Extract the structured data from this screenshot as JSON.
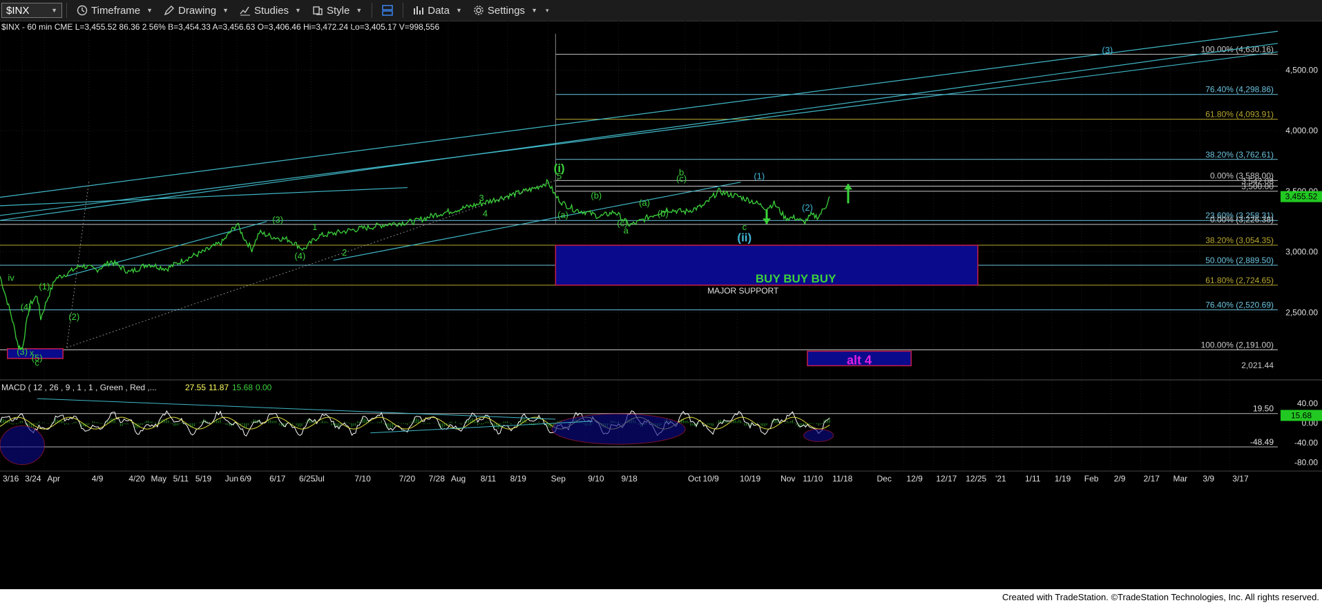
{
  "toolbar": {
    "symbol": "$INX",
    "items": [
      {
        "label": "Timeframe",
        "icon": "clock-icon"
      },
      {
        "label": "Drawing",
        "icon": "pencil-icon"
      },
      {
        "label": "Studies",
        "icon": "studies-icon"
      },
      {
        "label": "Style",
        "icon": "style-icon"
      },
      {
        "label": "Data",
        "icon": "data-icon"
      },
      {
        "label": "Settings",
        "icon": "gear-icon"
      }
    ]
  },
  "info_line": "$INX - 60 min  CME  L=3,455.52  86.36  2.56%  B=3,454.33  A=3,456.63  O=3,406.46  Hi=3,472.24  Lo=3,405.17  V=998,556",
  "footer": "Created with TradeStation. ©TradeStation Technologies, Inc. All rights reserved.",
  "colors": {
    "price": "#3cd23c",
    "trend": "#40b8c8",
    "support_box": "#0a0a8c",
    "support_border": "#c81e4b",
    "fib_blue": "#6cc4e0",
    "fib_olive": "#b8a830",
    "label_green": "#3cd23c",
    "label_cyan": "#40b8d8",
    "last_price_bg": "#22c822",
    "alt_text": "#e020e0"
  },
  "chart_data": [
    {
      "type": "line",
      "name": "price",
      "title": "$INX - 60 min",
      "ylim": [
        2000,
        4850
      ],
      "y_ticks": [
        2500,
        3000,
        3500,
        4000,
        4500
      ],
      "y_tick_labels": [
        "2,500.00",
        "3,000.00",
        "3,500.00",
        "4,000.00",
        "4,500.00"
      ],
      "last_price_label": "3,455.52",
      "x_tick_labels": [
        "3/16",
        "3/24",
        "Apr",
        "4/9",
        "4/20",
        "May",
        "5/11",
        "5/19",
        "Jun",
        "6/9",
        "6/17",
        "6/25",
        "Jul",
        "7/10",
        "7/20",
        "7/28",
        "Aug",
        "8/11",
        "8/19",
        "Sep",
        "9/10",
        "9/18",
        "Oct",
        "10/9",
        "10/19",
        "Nov",
        "11/10",
        "11/18",
        "Dec",
        "12/9",
        "12/17",
        "12/25",
        "'21",
        "1/11",
        "1/19",
        "Feb",
        "2/9",
        "2/17",
        "Mar",
        "3/9",
        "3/17"
      ],
      "x_index": [
        0,
        6,
        12,
        24,
        34,
        40,
        46,
        52,
        60,
        64,
        72,
        80,
        84,
        95,
        107,
        115,
        121,
        129,
        137,
        148,
        158,
        167,
        185,
        189,
        199,
        210,
        216,
        224,
        236,
        244,
        252,
        260,
        268,
        276,
        284,
        292,
        300,
        308,
        316,
        324,
        332
      ],
      "x_range": [
        0,
        345
      ],
      "price_points": [
        [
          0,
          2800
        ],
        [
          3,
          2480
        ],
        [
          5,
          2220
        ],
        [
          6,
          2200
        ],
        [
          8,
          2560
        ],
        [
          10,
          2640
        ],
        [
          11,
          2450
        ],
        [
          13,
          2630
        ],
        [
          15,
          2780
        ],
        [
          18,
          2820
        ],
        [
          22,
          2890
        ],
        [
          26,
          2850
        ],
        [
          30,
          2920
        ],
        [
          35,
          2830
        ],
        [
          40,
          2900
        ],
        [
          45,
          2860
        ],
        [
          50,
          2940
        ],
        [
          55,
          3000
        ],
        [
          60,
          3080
        ],
        [
          64,
          3230
        ],
        [
          66,
          3110
        ],
        [
          68,
          3020
        ],
        [
          70,
          3160
        ],
        [
          74,
          3120
        ],
        [
          78,
          3100
        ],
        [
          82,
          3020
        ],
        [
          86,
          3130
        ],
        [
          95,
          3180
        ],
        [
          105,
          3230
        ],
        [
          112,
          3250
        ],
        [
          118,
          3310
        ],
        [
          125,
          3360
        ],
        [
          130,
          3400
        ],
        [
          137,
          3460
        ],
        [
          144,
          3520
        ],
        [
          148,
          3575
        ],
        [
          150,
          3460
        ],
        [
          152,
          3400
        ],
        [
          155,
          3350
        ],
        [
          158,
          3330
        ],
        [
          162,
          3290
        ],
        [
          166,
          3330
        ],
        [
          170,
          3220
        ],
        [
          172,
          3240
        ],
        [
          176,
          3300
        ],
        [
          180,
          3350
        ],
        [
          185,
          3330
        ],
        [
          190,
          3380
        ],
        [
          194,
          3500
        ],
        [
          196,
          3480
        ],
        [
          199,
          3460
        ],
        [
          203,
          3420
        ],
        [
          207,
          3360
        ],
        [
          209,
          3400
        ],
        [
          212,
          3280
        ],
        [
          215,
          3280
        ],
        [
          217,
          3240
        ],
        [
          219,
          3300
        ],
        [
          221,
          3290
        ],
        [
          223,
          3380
        ],
        [
          224,
          3455.52
        ]
      ],
      "fib_levels": [
        {
          "label": "100.00% (4,630.16)",
          "value": 4630.16
        },
        {
          "label": "76.40% (4,298.86)",
          "value": 4298.86
        },
        {
          "label": "61.80% (4,093.91)",
          "value": 4093.91
        },
        {
          "label": "38.20% (3,762.61)",
          "value": 3762.61
        },
        {
          "label": "0.00% (3,588.00)",
          "value": 3588.0
        },
        {
          "label": "3,542.08",
          "value": 3542.08
        },
        {
          "label": "3,500.00",
          "value": 3500.0
        },
        {
          "label": "23.60% (3,258.31)",
          "value": 3258.31
        },
        {
          "label": "0.00% (3,226.38)",
          "value": 3226.38
        },
        {
          "label": "38.20% (3,054.35)",
          "value": 3054.35
        },
        {
          "label": "50.00% (2,889.50)",
          "value": 2889.5
        },
        {
          "label": "61.80% (2,724.65)",
          "value": 2724.65
        },
        {
          "label": "76.40% (2,520.69)",
          "value": 2520.69
        },
        {
          "label": "100.00% (2,191.00)",
          "value": 2191.0
        }
      ],
      "zones": [
        {
          "name": "buy-zone",
          "label": "BUY BUY BUY",
          "sublabel": "MAJOR SUPPORT",
          "x0": 150,
          "x1": 264,
          "y0": 2725,
          "y1": 3054
        },
        {
          "name": "alt-zone",
          "label": "alt 4",
          "x0": 218,
          "x1": 246,
          "y0": 2060,
          "y1": 2180
        },
        {
          "name": "low-zone",
          "label": "x",
          "x0": 2,
          "x1": 17,
          "y0": 2120,
          "y1": 2200
        }
      ],
      "off_scale_label": "2,021.44",
      "wave_labels": [
        {
          "text": "(i)",
          "x": 151,
          "y": 3660,
          "color": "green",
          "circled": true
        },
        {
          "text": "(ii)",
          "x": 201,
          "y": 3085,
          "color": "cyan",
          "circled": true
        },
        {
          "text": "(1)",
          "x": 205,
          "y": 3600,
          "color": "cyan"
        },
        {
          "text": "(2)",
          "x": 218,
          "y": 3340,
          "color": "cyan"
        },
        {
          "text": "(3)",
          "x": 299,
          "y": 4640,
          "color": "cyan"
        },
        {
          "text": "b",
          "x": 184,
          "y": 3630,
          "color": "green"
        },
        {
          "text": "c",
          "x": 201,
          "y": 3180,
          "color": "green"
        },
        {
          "text": "a",
          "x": 169,
          "y": 3150,
          "color": "green"
        },
        {
          "text": "5",
          "x": 151,
          "y": 3600,
          "color": "green"
        },
        {
          "text": "(a)",
          "x": 152,
          "y": 3280,
          "color": "green"
        },
        {
          "text": "(b)",
          "x": 161,
          "y": 3440,
          "color": "green"
        },
        {
          "text": "(c)",
          "x": 168,
          "y": 3210,
          "color": "green"
        },
        {
          "text": "(a)",
          "x": 174,
          "y": 3380,
          "color": "green"
        },
        {
          "text": "(b)",
          "x": 179,
          "y": 3290,
          "color": "green"
        },
        {
          "text": "(c)",
          "x": 184,
          "y": 3580,
          "color": "green"
        },
        {
          "text": "3",
          "x": 130,
          "y": 3420,
          "color": "green"
        },
        {
          "text": "4",
          "x": 131,
          "y": 3290,
          "color": "green"
        },
        {
          "text": "(3)",
          "x": 75,
          "y": 3240,
          "color": "green"
        },
        {
          "text": "(4)",
          "x": 81,
          "y": 2940,
          "color": "green"
        },
        {
          "text": "1",
          "x": 85,
          "y": 3180,
          "color": "green"
        },
        {
          "text": "2",
          "x": 93,
          "y": 2970,
          "color": "green"
        },
        {
          "text": "(1)",
          "x": 12,
          "y": 2690,
          "color": "green"
        },
        {
          "text": "(2)",
          "x": 20,
          "y": 2440,
          "color": "green"
        },
        {
          "text": "(4)",
          "x": 7,
          "y": 2520,
          "color": "green"
        },
        {
          "text": "(3)",
          "x": 6,
          "y": 2150,
          "color": "green"
        },
        {
          "text": "(5)",
          "x": 10,
          "y": 2100,
          "color": "green"
        },
        {
          "text": "c",
          "x": 10,
          "y": 2060,
          "color": "green"
        },
        {
          "text": "iv",
          "x": 3,
          "y": 2760,
          "color": "green"
        }
      ],
      "arrows": [
        {
          "dir": "up",
          "x": 229,
          "from": 3400,
          "to": 3560
        },
        {
          "dir": "down",
          "x": 207,
          "from": 3350,
          "to": 3230
        }
      ]
    },
    {
      "type": "line",
      "name": "macd",
      "title": "MACD ( 12 , 26 , 9 , 1 , 1 , Green , Red ,...",
      "values_label": [
        "27.55",
        "11.87",
        "15.68",
        "0.00"
      ],
      "ylim": [
        -95,
        60
      ],
      "y_ticks": [
        40,
        0,
        -40,
        -80
      ],
      "y_tick_labels": [
        "40.00",
        "0.00",
        "-40.00",
        "-80.00"
      ],
      "level_labels": [
        "19.50",
        "15.68",
        "-48.49"
      ]
    }
  ]
}
